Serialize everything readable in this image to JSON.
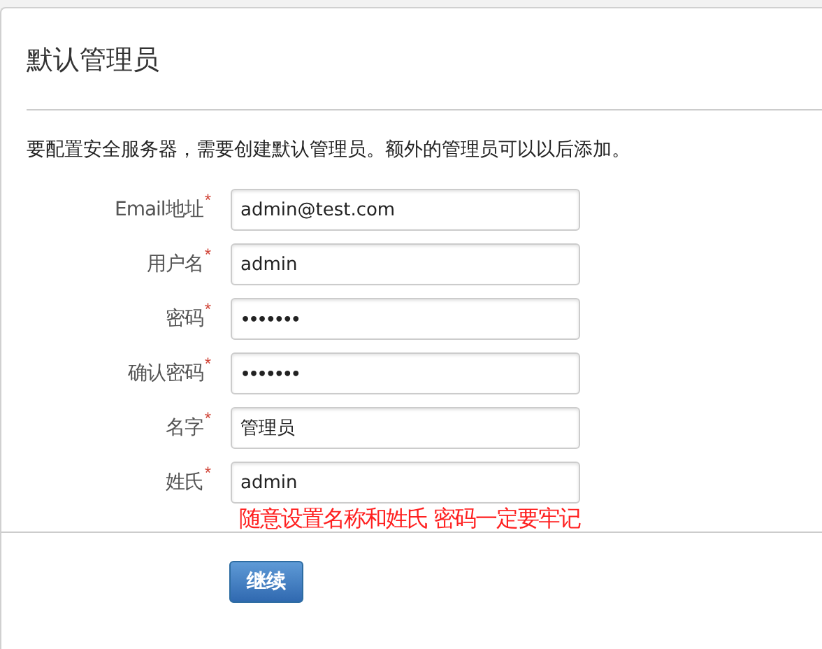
{
  "title": "默认管理员",
  "intro": "要配置安全服务器，需要创建默认管理员。额外的管理员可以以后添加。",
  "fields": [
    {
      "label": "Email地址",
      "required_mark": "*",
      "kind": "text",
      "value": "admin@test.com"
    },
    {
      "label": "用户名",
      "required_mark": "*",
      "kind": "text",
      "value": "admin"
    },
    {
      "label": "密码",
      "required_mark": "*",
      "kind": "password",
      "value": "•••••••"
    },
    {
      "label": "确认密码",
      "required_mark": "*",
      "kind": "password",
      "value": "•••••••"
    },
    {
      "label": "名字",
      "required_mark": "*",
      "kind": "text",
      "value": "管理员"
    },
    {
      "label": "姓氏",
      "required_mark": "*",
      "kind": "text",
      "value": "admin"
    }
  ],
  "annotation": "随意设置名称和姓氏 密码一定要牢记",
  "continue_button": "继续"
}
